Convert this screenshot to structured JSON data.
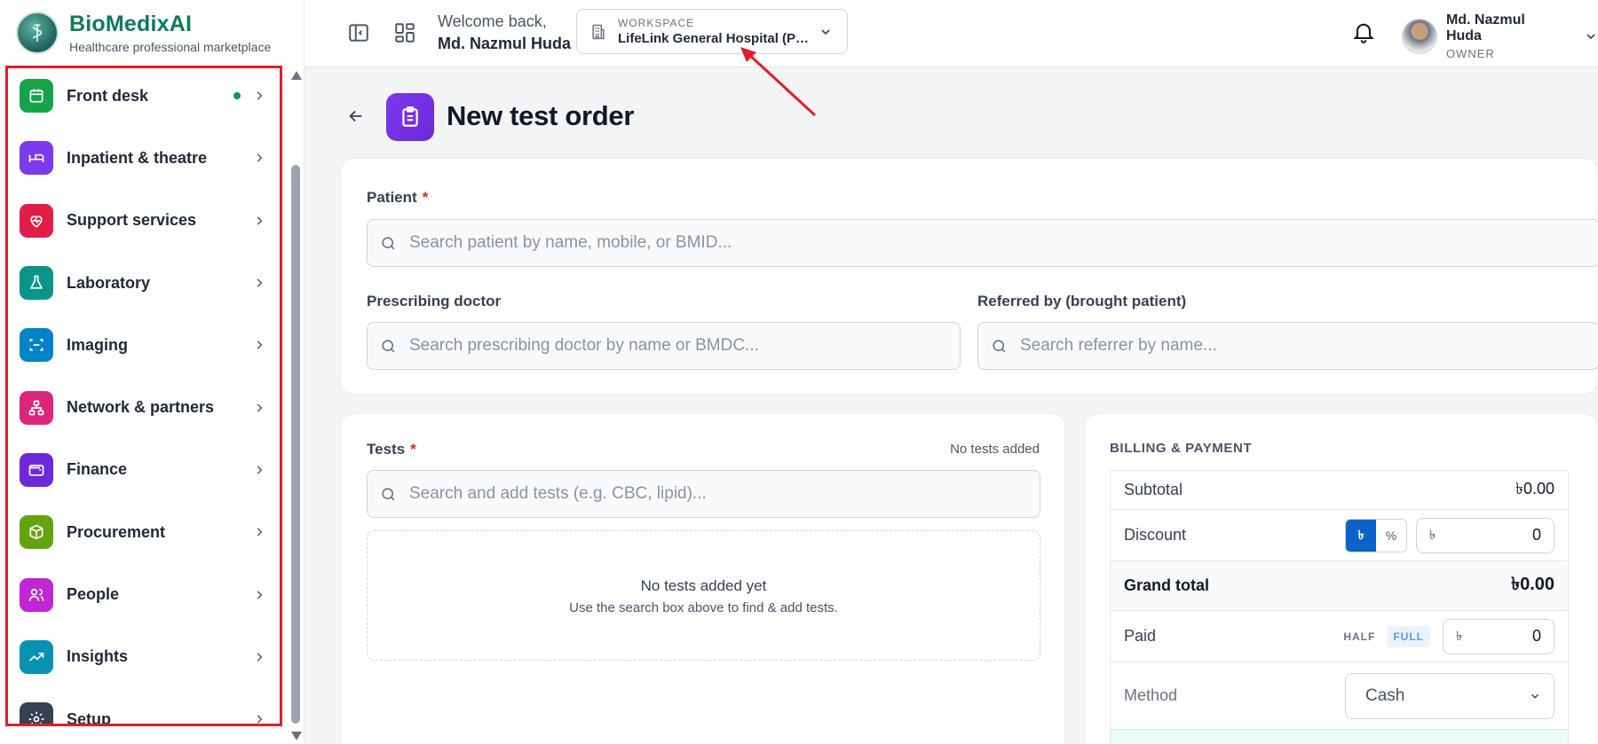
{
  "brand": {
    "name": "BioMedixAI",
    "tagline": "Healthcare professional marketplace"
  },
  "sidebar": {
    "items": [
      {
        "label": "Front desk",
        "icon": "calendar-icon",
        "color": "#16a34a",
        "active_dot": true
      },
      {
        "label": "Inpatient & theatre",
        "icon": "bed-icon",
        "color": "#7c3aed"
      },
      {
        "label": "Support services",
        "icon": "heart-pulse-icon",
        "color": "#e11d48"
      },
      {
        "label": "Laboratory",
        "icon": "flask-icon",
        "color": "#0d9488"
      },
      {
        "label": "Imaging",
        "icon": "scan-icon",
        "color": "#0284c7"
      },
      {
        "label": "Network & partners",
        "icon": "network-icon",
        "color": "#db2777"
      },
      {
        "label": "Finance",
        "icon": "wallet-icon",
        "color": "#6d28d9"
      },
      {
        "label": "Procurement",
        "icon": "package-icon",
        "color": "#65a30d"
      },
      {
        "label": "People",
        "icon": "users-icon",
        "color": "#c026d3"
      },
      {
        "label": "Insights",
        "icon": "trending-up-icon",
        "color": "#0891b2"
      },
      {
        "label": "Setup",
        "icon": "gear-icon",
        "color": "#374151"
      }
    ]
  },
  "topbar": {
    "welcome": "Welcome back,",
    "user_name": "Md. Nazmul Huda",
    "workspace_label": "WORKSPACE",
    "workspace_value": "LifeLink General Hospital (PVT) Ltd",
    "user_role": "OWNER"
  },
  "page": {
    "title": "New test order"
  },
  "patient": {
    "label": "Patient",
    "required": "*",
    "placeholder": "Search patient by name, mobile, or BMID..."
  },
  "doctor": {
    "label": "Prescribing doctor",
    "placeholder": "Search prescribing doctor by name or BMDC..."
  },
  "referrer": {
    "label": "Referred by (brought patient)",
    "placeholder": "Search referrer by name..."
  },
  "tests": {
    "label": "Tests",
    "required": "*",
    "status": "No tests added",
    "placeholder": "Search and add tests (e.g. CBC, lipid)...",
    "empty_title": "No tests added yet",
    "empty_sub": "Use the search box above to find & add tests."
  },
  "billing": {
    "heading": "BILLING & PAYMENT",
    "subtotal_label": "Subtotal",
    "subtotal_value": "৳0.00",
    "discount_label": "Discount",
    "discount_toggle_amount": "৳",
    "discount_toggle_percent": "%",
    "currency_symbol": "৳",
    "discount_value": "0",
    "grand_label": "Grand total",
    "grand_value": "৳0.00",
    "paid_label": "Paid",
    "paid_half": "HALF",
    "paid_full": "FULL",
    "paid_value": "0",
    "method_label": "Method",
    "method_value": "Cash"
  }
}
